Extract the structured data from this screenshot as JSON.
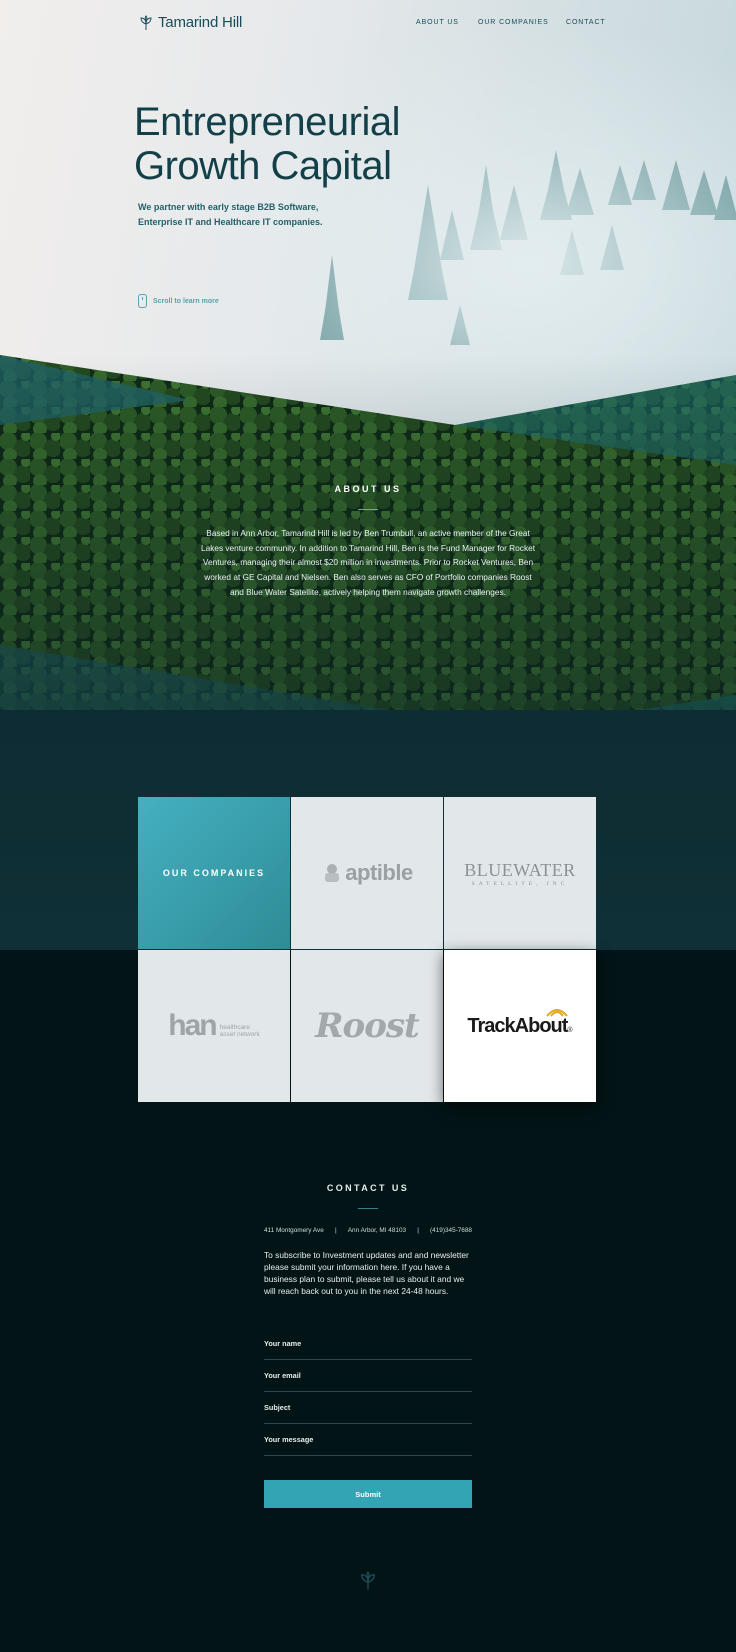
{
  "header": {
    "logo_text": "Tamarind Hill",
    "nav": [
      "About Us",
      "Our Companies",
      "Contact"
    ]
  },
  "hero": {
    "title_line1": "Entrepreneurial",
    "title_line2": "Growth Capital",
    "subtitle_line1": "We partner with early stage B2B Software,",
    "subtitle_line2": "Enterprise IT and Healthcare IT companies.",
    "scroll_label": "Scroll to learn more"
  },
  "about": {
    "title": "ABOUT US",
    "body": "Based in Ann Arbor, Tamarind Hill is led by Ben Trumbull, an active member of the Great Lakes venture community. In addition to Tamarind Hill, Ben is the Fund Manager for Rocket Ventures, managing their almost $20 million in investments. Prior to Rocket Ventures, Ben worked at GE Capital and Nielsen. Ben also serves as CFO of Portfolio companies Roost and Blue Water Satellite, actively helping them navigate growth challenges."
  },
  "companies": {
    "title": "OUR COMPANIES",
    "logos": {
      "aptible": "aptible",
      "bluewater_main": "BLUEWATER",
      "bluewater_sub": "SATELLITE, INC",
      "han_letters": "han",
      "han_sub_line1": "healthcare",
      "han_sub_line2": "asset network",
      "roost": "Roost",
      "trackabout": "TrackAbout",
      "trackabout_mark": "®"
    }
  },
  "contact": {
    "title": "CONTACT US",
    "address": "411 Montgomery Ave",
    "sep1": "|",
    "city": "Ann Arbor, MI 48103",
    "sep2": "|",
    "phone": "(419)345-7688",
    "intro": "To subscribe to Investment updates and and newsletter please submit your information here. If you have a business plan to submit, please tell us about it and we will reach back out to you in the next 24-48 hours.",
    "fields": [
      "Your name",
      "Your email",
      "Subject",
      "Your message"
    ],
    "submit_label": "Submit"
  },
  "colors": {
    "accent": "#32a4b3",
    "dark_bg": "#031416",
    "brand_text": "#174d58"
  }
}
